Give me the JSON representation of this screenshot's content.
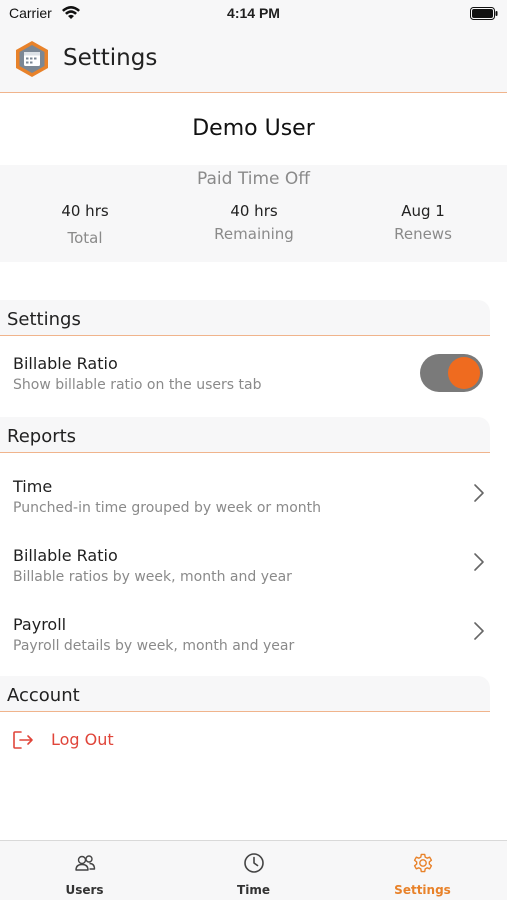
{
  "status_bar": {
    "carrier": "Carrier",
    "time": "4:14 PM"
  },
  "header": {
    "title": "Settings",
    "app_icon": "calendar-hexagon-icon"
  },
  "user": {
    "name": "Demo User"
  },
  "pto": {
    "title": "Paid Time Off",
    "total": {
      "value": "40 hrs",
      "label": "Total"
    },
    "remaining": {
      "value": "40 hrs",
      "label": "Remaining"
    },
    "renews": {
      "value": "Aug 1",
      "label": "Renews"
    }
  },
  "settings_section": {
    "header": "Settings",
    "billable_ratio": {
      "title": "Billable Ratio",
      "subtitle": "Show billable ratio on the users tab",
      "enabled": true
    }
  },
  "reports_section": {
    "header": "Reports",
    "items": [
      {
        "title": "Time",
        "subtitle": "Punched-in time grouped by week or month"
      },
      {
        "title": "Billable Ratio",
        "subtitle": "Billable ratios by week, month and year"
      },
      {
        "title": "Payroll",
        "subtitle": "Payroll details by week, month and year"
      }
    ]
  },
  "account_section": {
    "header": "Account",
    "logout_label": "Log Out"
  },
  "tab_bar": {
    "tabs": [
      {
        "label": "Users",
        "icon": "users-icon",
        "active": false
      },
      {
        "label": "Time",
        "icon": "clock-icon",
        "active": false
      },
      {
        "label": "Settings",
        "icon": "gear-icon",
        "active": true
      }
    ]
  },
  "colors": {
    "accent": "#ef6b1f",
    "divider": "#f0b48c",
    "logout": "#e0453a",
    "panel_bg": "#f7f7f8"
  }
}
